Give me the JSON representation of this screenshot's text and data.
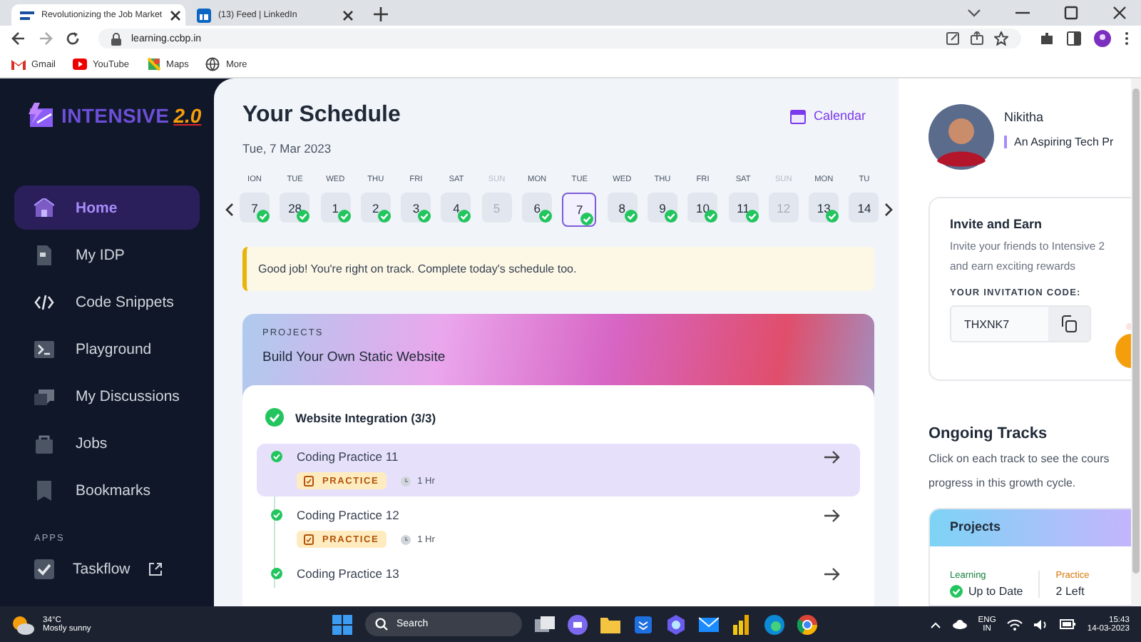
{
  "browser": {
    "tabs": [
      {
        "title": "Revolutionizing the Job Market",
        "selected": true
      },
      {
        "title": "(13) Feed | LinkedIn",
        "selected": false
      }
    ],
    "url": "learning.ccbp.in",
    "bookmarks": [
      "Gmail",
      "YouTube",
      "Maps",
      "More"
    ]
  },
  "sidebar": {
    "logo": {
      "text": "INTENSIVE",
      "version": "2.0"
    },
    "items": [
      {
        "label": "Home",
        "selected": true
      },
      {
        "label": "My IDP",
        "selected": false
      },
      {
        "label": "Code Snippets",
        "selected": false
      },
      {
        "label": "Playground",
        "selected": false
      },
      {
        "label": "My Discussions",
        "selected": false
      },
      {
        "label": "Jobs",
        "selected": false
      },
      {
        "label": "Bookmarks",
        "selected": false
      }
    ],
    "apps_heading": "APPS",
    "apps": [
      {
        "label": "Taskflow"
      }
    ]
  },
  "schedule": {
    "title": "Your Schedule",
    "date": "Tue, 7 Mar 2023",
    "calendar_label": "Calendar",
    "days": [
      {
        "weekday": "ION",
        "day": "7",
        "done": true,
        "disabled": false,
        "selected": false
      },
      {
        "weekday": "TUE",
        "day": "28",
        "done": true,
        "disabled": false,
        "selected": false
      },
      {
        "weekday": "WED",
        "day": "1",
        "done": true,
        "disabled": false,
        "selected": false
      },
      {
        "weekday": "THU",
        "day": "2",
        "done": true,
        "disabled": false,
        "selected": false
      },
      {
        "weekday": "FRI",
        "day": "3",
        "done": true,
        "disabled": false,
        "selected": false
      },
      {
        "weekday": "SAT",
        "day": "4",
        "done": true,
        "disabled": false,
        "selected": false
      },
      {
        "weekday": "SUN",
        "day": "5",
        "done": false,
        "disabled": true,
        "selected": false
      },
      {
        "weekday": "MON",
        "day": "6",
        "done": true,
        "disabled": false,
        "selected": false
      },
      {
        "weekday": "TUE",
        "day": "7",
        "done": true,
        "disabled": false,
        "selected": true
      },
      {
        "weekday": "WED",
        "day": "8",
        "done": true,
        "disabled": false,
        "selected": false
      },
      {
        "weekday": "THU",
        "day": "9",
        "done": true,
        "disabled": false,
        "selected": false
      },
      {
        "weekday": "FRI",
        "day": "10",
        "done": true,
        "disabled": false,
        "selected": false
      },
      {
        "weekday": "SAT",
        "day": "11",
        "done": true,
        "disabled": false,
        "selected": false
      },
      {
        "weekday": "SUN",
        "day": "12",
        "done": false,
        "disabled": true,
        "selected": false
      },
      {
        "weekday": "MON",
        "day": "13",
        "done": true,
        "disabled": false,
        "selected": false
      },
      {
        "weekday": "TU",
        "day": "14",
        "done": false,
        "disabled": false,
        "selected": false
      }
    ],
    "message": "Good job! You're right on track. Complete today's schedule too."
  },
  "project": {
    "eyebrow": "PROJECTS",
    "title": "Build Your Own Static Website",
    "module": {
      "title": "Website Integration (3/3)",
      "done": true
    },
    "items": [
      {
        "title": "Coding Practice 11",
        "done": true,
        "selected": true,
        "tag": "PRACTICE",
        "duration": "1 Hr"
      },
      {
        "title": "Coding Practice 12",
        "done": true,
        "selected": false,
        "tag": "PRACTICE",
        "duration": "1 Hr"
      },
      {
        "title": "Coding Practice 13",
        "done": true,
        "selected": false
      }
    ]
  },
  "profile": {
    "name": "Nikitha",
    "tagline": "An Aspiring Tech Pr"
  },
  "invite": {
    "title": "Invite and Earn",
    "text": "Invite your friends to Intensive 2\nand earn exciting rewards",
    "code_label": "YOUR INVITATION CODE:",
    "code": "THXNK7"
  },
  "tracks": {
    "title": "Ongoing Tracks",
    "description": "Click on each track to see the cours\nprogress in this growth cycle.",
    "card": {
      "title": "Projects",
      "learning_label": "Learning",
      "learning_status": "Up to Date",
      "practice_label": "Practice",
      "practice_status": "2 Left"
    }
  },
  "taskbar": {
    "temperature": "34°C",
    "weather": "Mostly sunny",
    "search": "Search",
    "language": "ENG",
    "region": "IN",
    "time": "15:43",
    "date": "14-03-2023"
  }
}
